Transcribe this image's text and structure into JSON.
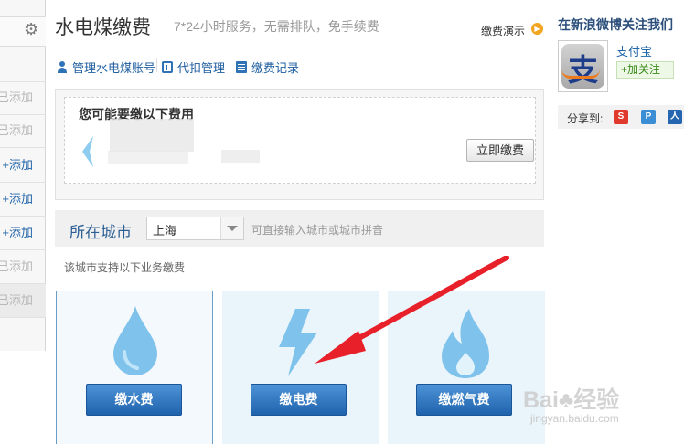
{
  "sidebar": {
    "items": [
      {
        "label": "已添加",
        "state": "done"
      },
      {
        "label": "已添加",
        "state": "done"
      },
      {
        "label": "+添加",
        "state": "add"
      },
      {
        "label": "+添加",
        "state": "add"
      },
      {
        "label": "+添加",
        "state": "add"
      },
      {
        "label": "已添加",
        "state": "done"
      },
      {
        "label": "已添加",
        "state": "done"
      }
    ]
  },
  "header": {
    "title": "水电煤缴费",
    "subtitle": "7*24小时服务，无需排队，免手续费",
    "demo_label": "缴费演示"
  },
  "nav": {
    "items": [
      {
        "label": "管理水电煤账号",
        "icon": "user-icon"
      },
      {
        "label": "代扣管理",
        "icon": "card-icon"
      },
      {
        "label": "缴费记录",
        "icon": "list-icon"
      }
    ]
  },
  "pending": {
    "title": "您可能要缴以下费用",
    "button": "立即缴费"
  },
  "city": {
    "label": "所在城市",
    "value": "上海",
    "hint": "可直接输入城市或城市拼音",
    "support_text": "该城市支持以下业务缴费"
  },
  "services": [
    {
      "label": "缴水费",
      "icon": "water-drop-icon",
      "color": "#7fc3ec"
    },
    {
      "label": "缴电费",
      "icon": "lightning-icon",
      "color": "#7fc3ec"
    },
    {
      "label": "缴燃气费",
      "icon": "gas-flame-icon",
      "color": "#7fc3ec"
    }
  ],
  "weibo": {
    "title": "在新浪微博关注我们",
    "account": "支付宝",
    "follow": "+加关注"
  },
  "share": {
    "label": "分享到:",
    "icons": [
      "sohu-share-icon",
      "qq-share-icon",
      "renren-share-icon"
    ]
  },
  "colors": {
    "primary_button": "#1f63ad",
    "link": "#1f5ea0",
    "annotation_arrow": "#e8202a"
  }
}
